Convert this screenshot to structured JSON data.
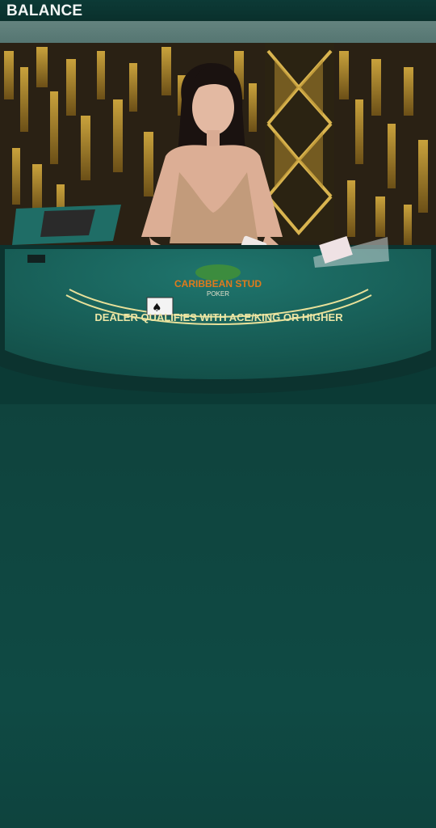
{
  "header": {
    "balance_label": "BALANCE"
  },
  "table": {
    "game_logo_text": "CARIBBEAN STUD",
    "game_logo_subtext": "POKER",
    "felt_text": "DEALER QUALIFIES WITH ACE/KING OR HIGHER",
    "felt_color": "#1b6a63",
    "rail_color": "#0d3531"
  },
  "colors": {
    "lower_panel": "#0f4842",
    "topbar": "#0b3632"
  }
}
